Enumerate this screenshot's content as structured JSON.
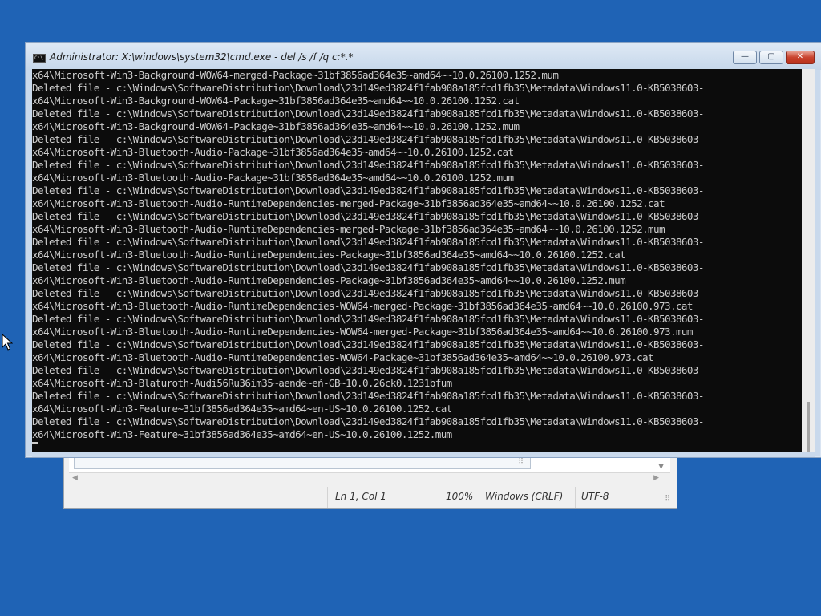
{
  "colors": {
    "desktop": "#1f63b5",
    "console_bg": "#0c0c0c",
    "console_text": "#cccccc",
    "close_button": "#c9432e"
  },
  "notepad": {
    "status": {
      "position": "Ln 1, Col 1",
      "zoom": "100%",
      "line_endings": "Windows (CRLF)",
      "encoding": "UTF-8"
    }
  },
  "cmd": {
    "title": "Administrator: X:\\windows\\system32\\cmd.exe - del  /s /f /q c:*.*",
    "icon": "console-icon",
    "buttons": {
      "minimize": "—",
      "maximize": "▢",
      "close": "✕"
    },
    "lines": [
      "x64\\Microsoft-Win3-Background-WOW64-merged-Package~31bf3856ad364e35~amd64~~10.0.26100.1252.mum",
      "Deleted file - c:\\Windows\\SoftwareDistribution\\Download\\23d149ed3824f1fab908a185fcd1fb35\\Metadata\\Windows11.0-KB5038603-",
      "x64\\Microsoft-Win3-Background-WOW64-Package~31bf3856ad364e35~amd64~~10.0.26100.1252.cat",
      "Deleted file - c:\\Windows\\SoftwareDistribution\\Download\\23d149ed3824f1fab908a185fcd1fb35\\Metadata\\Windows11.0-KB5038603-",
      "x64\\Microsoft-Win3-Background-WOW64-Package~31bf3856ad364e35~amd64~~10.0.26100.1252.mum",
      "Deleted file - c:\\Windows\\SoftwareDistribution\\Download\\23d149ed3824f1fab908a185fcd1fb35\\Metadata\\Windows11.0-KB5038603-",
      "x64\\Microsoft-Win3-Bluetooth-Audio-Package~31bf3856ad364e35~amd64~~10.0.26100.1252.cat",
      "Deleted file - c:\\Windows\\SoftwareDistribution\\Download\\23d149ed3824f1fab908a185fcd1fb35\\Metadata\\Windows11.0-KB5038603-",
      "x64\\Microsoft-Win3-Bluetooth-Audio-Package~31bf3856ad364e35~amd64~~10.0.26100.1252.mum",
      "Deleted file - c:\\Windows\\SoftwareDistribution\\Download\\23d149ed3824f1fab908a185fcd1fb35\\Metadata\\Windows11.0-KB5038603-",
      "x64\\Microsoft-Win3-Bluetooth-Audio-RuntimeDependencies-merged-Package~31bf3856ad364e35~amd64~~10.0.26100.1252.cat",
      "Deleted file - c:\\Windows\\SoftwareDistribution\\Download\\23d149ed3824f1fab908a185fcd1fb35\\Metadata\\Windows11.0-KB5038603-",
      "x64\\Microsoft-Win3-Bluetooth-Audio-RuntimeDependencies-merged-Package~31bf3856ad364e35~amd64~~10.0.26100.1252.mum",
      "Deleted file - c:\\Windows\\SoftwareDistribution\\Download\\23d149ed3824f1fab908a185fcd1fb35\\Metadata\\Windows11.0-KB5038603-",
      "x64\\Microsoft-Win3-Bluetooth-Audio-RuntimeDependencies-Package~31bf3856ad364e35~amd64~~10.0.26100.1252.cat",
      "Deleted file - c:\\Windows\\SoftwareDistribution\\Download\\23d149ed3824f1fab908a185fcd1fb35\\Metadata\\Windows11.0-KB5038603-",
      "x64\\Microsoft-Win3-Bluetooth-Audio-RuntimeDependencies-Package~31bf3856ad364e35~amd64~~10.0.26100.1252.mum",
      "Deleted file - c:\\Windows\\SoftwareDistribution\\Download\\23d149ed3824f1fab908a185fcd1fb35\\Metadata\\Windows11.0-KB5038603-",
      "x64\\Microsoft-Win3-Bluetooth-Audio-RuntimeDependencies-WOW64-merged-Package~31bf3856ad364e35~amd64~~10.0.26100.973.cat",
      "Deleted file - c:\\Windows\\SoftwareDistribution\\Download\\23d149ed3824f1fab908a185fcd1fb35\\Metadata\\Windows11.0-KB5038603-",
      "x64\\Microsoft-Win3-Bluetooth-Audio-RuntimeDependencies-WOW64-merged-Package~31bf3856ad364e35~amd64~~10.0.26100.973.mum",
      "Deleted file - c:\\Windows\\SoftwareDistribution\\Download\\23d149ed3824f1fab908a185fcd1fb35\\Metadata\\Windows11.0-KB5038603-",
      "x64\\Microsoft-Win3-Bluetooth-Audio-RuntimeDependencies-WOW64-Package~31bf3856ad364e35~amd64~~10.0.26100.973.cat",
      "Deleted file - c:\\Windows\\SoftwareDistribution\\Download\\23d149ed3824f1fab908a185fcd1fb35\\Metadata\\Windows11.0-KB5038603-",
      "x64\\Microsoft-Win3-Blaturoth-Audi56Ru36im35~aende~eń-GB~10.0.26ck0.1231bfum",
      "Deleted file - c:\\Windows\\SoftwareDistribution\\Download\\23d149ed3824f1fab908a185fcd1fb35\\Metadata\\Windows11.0-KB5038603-",
      "x64\\Microsoft-Win3-Feature~31bf3856ad364e35~amd64~en-US~10.0.26100.1252.cat",
      "Deleted file - c:\\Windows\\SoftwareDistribution\\Download\\23d149ed3824f1fab908a185fcd1fb35\\Metadata\\Windows11.0-KB5038603-",
      "x64\\Microsoft-Win3-Feature~31bf3856ad364e35~amd64~en-US~10.0.26100.1252.mum"
    ]
  }
}
